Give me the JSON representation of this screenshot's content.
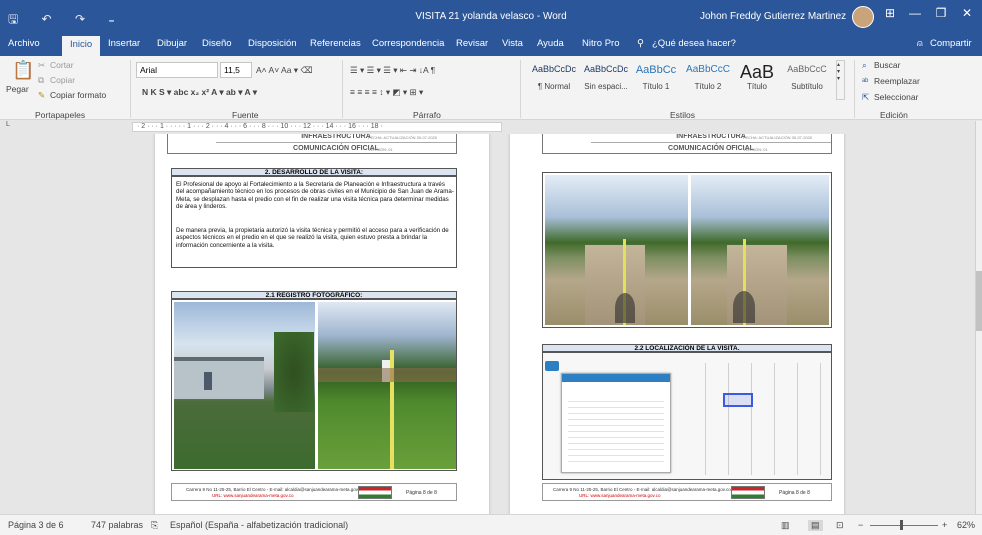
{
  "app": {
    "qa_icons": "🖫 ↶ ↷ ₌",
    "title": "VISITA 21 yolanda velasco  -  Word",
    "user": "Johon Freddy Gutierrez Martinez",
    "min": "—",
    "restore": "❐",
    "close": "✕",
    "ribbon_opts": "⊞"
  },
  "tabs": [
    "Archivo",
    "Inicio",
    "Insertar",
    "Dibujar",
    "Diseño",
    "Disposición",
    "Referencias",
    "Correspondencia",
    "Revisar",
    "Vista",
    "Ayuda",
    "Nitro Pro"
  ],
  "tellme": "¿Qué desea hacer?",
  "share": "Compartir",
  "clipboard": {
    "paste": "Pegar",
    "cut": "Cortar",
    "copy": "Copiar",
    "format": "Copiar formato",
    "label": "Portapapeles"
  },
  "font": {
    "name": "Arial",
    "size": "11,5",
    "label": "Fuente",
    "row1": "A˄  A˅  Aa ▾  ⌫",
    "row2": "N  K  S  ▾  abc  x₂  x²  A ▾  ab ▾  A ▾"
  },
  "paragraph": {
    "label": "Párrafo",
    "row1": "☰ ▾ ☰ ▾ ☰ ▾  ⇤ ⇥  ↓A  ¶",
    "row2": "≡  ≡  ≡  ≡  ↕ ▾  ◩ ▾  ⊞ ▾"
  },
  "styles": {
    "label": "Estilos",
    "items": [
      {
        "preview": "AaBbCcDc",
        "name": "¶ Normal"
      },
      {
        "preview": "AaBbCcDc",
        "name": "Sin espaci..."
      },
      {
        "preview": "AaBbCc",
        "name": "Título 1"
      },
      {
        "preview": "AaBbCcC",
        "name": "Título 2"
      },
      {
        "preview": "AaB",
        "name": "Título"
      },
      {
        "preview": "AaBbCcC",
        "name": "Subtítulo"
      }
    ]
  },
  "editing": {
    "search": "Buscar",
    "replace": "Reemplazar",
    "select": "Seleccionar",
    "label": "Edición"
  },
  "ruler": {
    "tab": "L",
    "marks": "· 2 · · · 1 · · · · · 1 · · · 2 · · · 4 · · · 6 · · · 8 · · · 10 · · · 12 · · · 14 · · · 16 · · · 18 ·"
  },
  "page_left": {
    "hdr1": "INFRAESTRUCTURA",
    "hdr2": "COMUNICACIÓN OFICIAL",
    "hdr_small1": "FECHA: ACTUALIZACIÓN 30-07-2020",
    "hdr_small2": "VERSIÓN: 01",
    "section": "2.   DESARROLLO DE LA VISITA:",
    "para1": "El Profesional de apoyo al Fortalecimiento a la Secretaria de Planeación e Infraestructura a través del acompañamiento técnico en los procesos de obras civiles en el Municipio de San Juan de Arama- Meta,  se desplazan hasta el predio con el fin de realizar una visita técnica para determinar medidas de área y linderos.",
    "para2": "De manera previa, la propietaria autorizó la visita técnica y permitió el acceso para a verificación de aspectos técnicos en el predio en el que se realizó la visita, quien estuvo presta a brindar la información concerniente a la visita.",
    "photos_title": "2.1      REGISTRO FOTOGRÁFICO:",
    "footer_addr": "Carrera 9 No 11-25-25, Barrio El Centro - E-mail: alcaldia@sanjuandearama-meta.gov.co",
    "footer_url": "URL: www.sanjuandearama-meta.gov.co",
    "footer_page": "Página 8 de 8"
  },
  "page_right": {
    "hdr1": "INFRAESTRUCTURA",
    "hdr2": "COMUNICACIÓN OFICIAL",
    "hdr_small1": "FECHA: ACTUALIZACIÓN 30-07-2020",
    "hdr_small2": "VERSIÓN: 01",
    "section": "2.2      LOCALIZACIÓN DE LA VISITA.",
    "footer_addr": "Carrera 9 No 11-25-25, Barrio El Centro - E-mail: alcaldia@sanjuandearama-meta.gov.co",
    "footer_url": "URL: www.sanjuandearama-meta.gov.co",
    "footer_page": "Página 8 de 8"
  },
  "status": {
    "page": "Página 3 de 6",
    "words": "747 palabras",
    "lang": "Español (España - alfabetización tradicional)",
    "zoom": "62%"
  }
}
